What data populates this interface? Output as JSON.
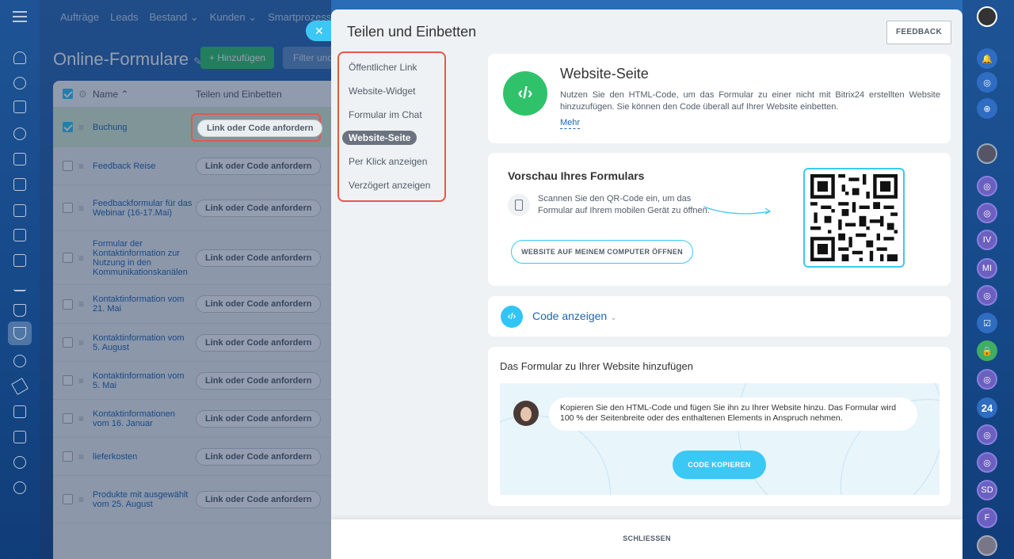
{
  "topnav": [
    "Aufträge",
    "Leads",
    "Bestand ⌄",
    "Kunden ⌄",
    "Smartprozesse ⌄"
  ],
  "page": {
    "title": "Online-Formulare",
    "add_label": "+ Hinzufügen",
    "filter_placeholder": "Filter und"
  },
  "grid": {
    "headers": {
      "name": "Name ⌃",
      "share": "Teilen und Einbetten"
    },
    "action_label": "Link oder Code anfordern",
    "rows": [
      {
        "name": "Buchung"
      },
      {
        "name": "Feedback Reise"
      },
      {
        "name": "Feedbackformular für das Webinar (16-17.Mai)"
      },
      {
        "name": "Formular der Kontaktinformation zur Nutzung in den Kommunikationskanälen"
      },
      {
        "name": "Kontaktinformation vom 21. Mai"
      },
      {
        "name": "Kontaktinformation vom 5. August"
      },
      {
        "name": "Kontaktinformation vom 5. Mai"
      },
      {
        "name": "Kontaktinformationen vom 16. Januar"
      },
      {
        "name": "lieferkosten"
      },
      {
        "name": "Produkte mit ausgewählt vom 25. August"
      }
    ]
  },
  "panel": {
    "title": "Teilen und Einbetten",
    "feedback_label": "FEEDBACK",
    "menu": [
      {
        "label": "Öffentlicher Link"
      },
      {
        "label": "Website-Widget"
      },
      {
        "label": "Formular im Chat"
      },
      {
        "label": "Website-Seite"
      },
      {
        "label": "Per Klick anzeigen"
      },
      {
        "label": "Verzögert anzeigen"
      }
    ],
    "active_menu": "Website-Seite",
    "website": {
      "icon_text": "‹/›",
      "title": "Website-Seite",
      "description": "Nutzen Sie den HTML-Code, um das Formular zu einer nicht mit Bitrix24 erstellten Website hinzuzufügen. Sie können den Code überall auf Ihrer Website einbetten.",
      "more": "Mehr"
    },
    "preview": {
      "title": "Vorschau Ihres Formulars",
      "hint": "Scannen Sie den QR-Code ein, um das Formular auf Ihrem mobilen Gerät zu öffnen.",
      "open_button": "WEBSITE AUF MEINEM COMPUTER ÖFFNEN"
    },
    "code": {
      "icon_text": "‹/›",
      "label": "Code anzeigen"
    },
    "add": {
      "title": "Das Formular zu Ihrer Website hinzufügen",
      "message": "Kopieren Sie den HTML-Code und fügen Sie ihn zu Ihrer Website hinzu. Das Formular wird 100 % der Seitenbreite oder des enthaltenen Elements in Anspruch nehmen.",
      "copy_button": "CODE KOPIEREN"
    },
    "close_label": "SCHLIESSEN"
  },
  "right_rail": {
    "badge_24": "24",
    "initials": [
      "IV",
      "MI",
      "SD",
      "F"
    ]
  },
  "colors": {
    "accent": "#3bc8f5",
    "green": "#2fc26b",
    "highlight": "#e8564a",
    "link": "#2067b0"
  }
}
